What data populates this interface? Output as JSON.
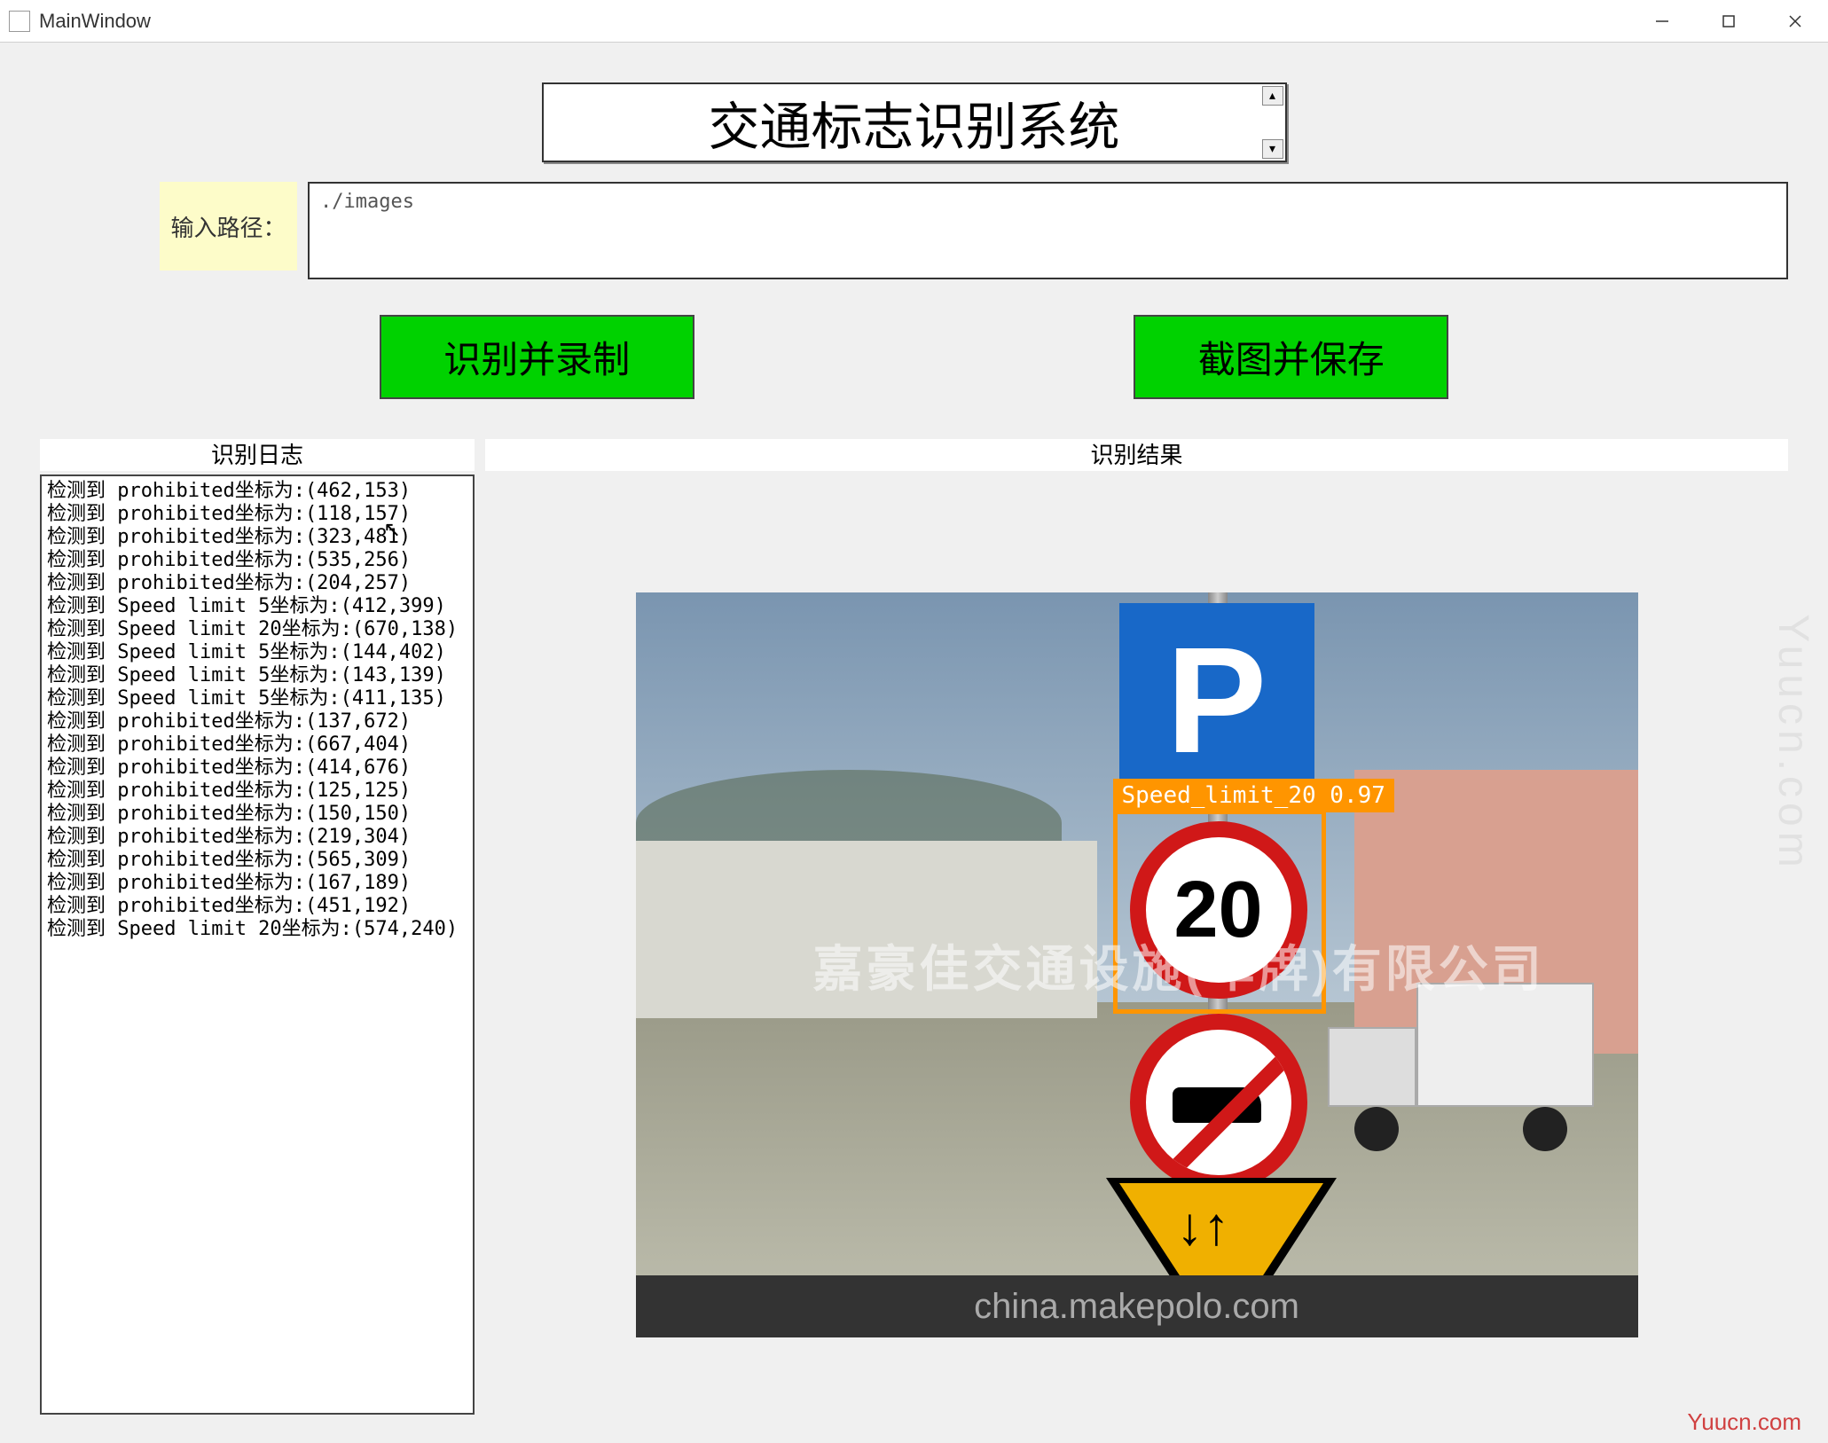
{
  "window": {
    "title": "MainWindow"
  },
  "banner": {
    "title": "交通标志识别系统"
  },
  "path": {
    "label": "输入路径：",
    "value": "./images"
  },
  "buttons": {
    "recognize": "识别并录制",
    "screenshot": "截图并保存"
  },
  "sections": {
    "log_header": "识别日志",
    "result_header": "识别结果"
  },
  "log": [
    "检测到 prohibited坐标为:(462,153)",
    "检测到 prohibited坐标为:(118,157)",
    "检测到 prohibited坐标为:(323,481)",
    "检测到 prohibited坐标为:(535,256)",
    "检测到 prohibited坐标为:(204,257)",
    "检测到 Speed limit 5坐标为:(412,399)",
    "检测到 Speed limit 20坐标为:(670,138)",
    "检测到 Speed limit 5坐标为:(144,402)",
    "检测到 Speed limit 5坐标为:(143,139)",
    "检测到 Speed limit 5坐标为:(411,135)",
    "检测到 prohibited坐标为:(137,672)",
    "检测到 prohibited坐标为:(667,404)",
    "检测到 prohibited坐标为:(414,676)",
    "检测到 prohibited坐标为:(125,125)",
    "检测到 prohibited坐标为:(150,150)",
    "检测到 prohibited坐标为:(219,304)",
    "检测到 prohibited坐标为:(565,309)",
    "检测到 prohibited坐标为:(167,189)",
    "检测到 prohibited坐标为:(451,192)",
    "检测到 Speed limit 20坐标为:(574,240)"
  ],
  "detection": {
    "bbox_label": "Speed_limit_20 0.97",
    "sign_p": "P",
    "sign_20": "20",
    "tri_arrows": "↓↑"
  },
  "image": {
    "watermark_center": "嘉豪佳交通设施(车牌)有限公司",
    "watermark_bottom": "china.makepolo.com"
  },
  "page_marks": {
    "side": "Yuucn.com",
    "footer": "Yuucn.com"
  }
}
